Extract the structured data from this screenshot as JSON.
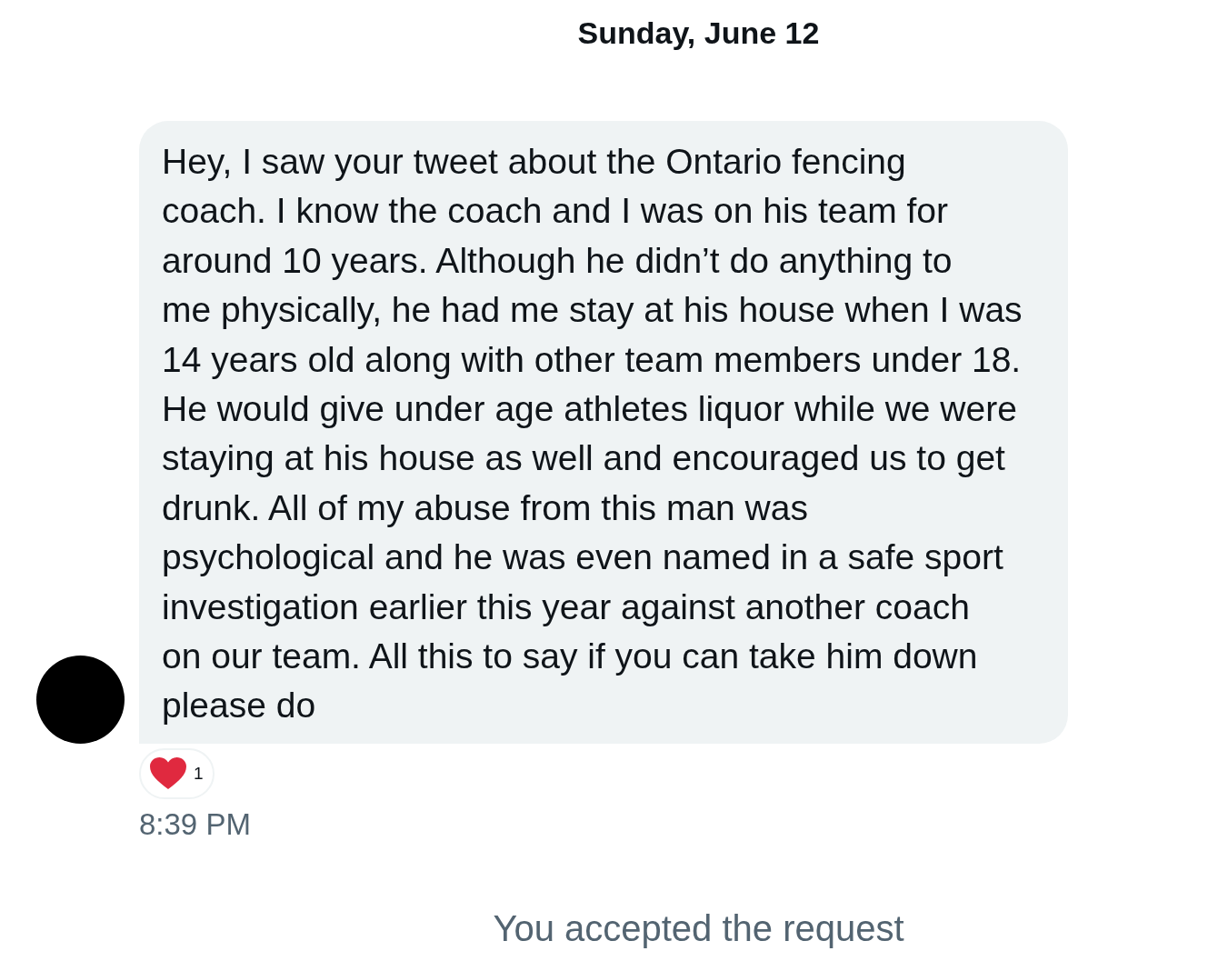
{
  "date_header": "Sunday, June 12",
  "message": {
    "lines": [
      "Hey, I saw your tweet about the Ontario fencing",
      "coach. I know the coach and I was on his team for",
      "around 10 years. Although he didn’t do anything to",
      "me physically, he had me stay at his house when I was",
      "14 years old along with other team members under 18.",
      "He would give under age athletes liquor while we were",
      "staying at his house as well and encouraged us to get",
      "drunk. All of my abuse from this man was",
      "psychological and he was even named in a safe sport",
      "investigation earlier this year against another coach",
      "on our team. All this to say if you can take him down",
      "please do"
    ],
    "reaction": {
      "count": "1"
    },
    "time": "8:39 PM"
  },
  "system_notice": "You accepted the request"
}
